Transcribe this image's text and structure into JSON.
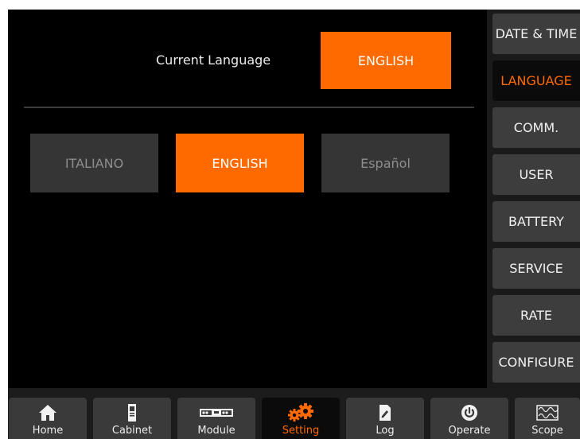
{
  "language_panel": {
    "current_label": "Current Language",
    "current_value": "ENGLISH",
    "options": [
      {
        "label": "ITALIANO",
        "selected": false
      },
      {
        "label": "ENGLISH",
        "selected": true
      },
      {
        "label": "Español",
        "selected": false
      }
    ]
  },
  "sidebar": {
    "items": [
      {
        "label": "DATE & TIME",
        "active": false
      },
      {
        "label": "LANGUAGE",
        "active": true
      },
      {
        "label": "COMM.",
        "active": false
      },
      {
        "label": "USER",
        "active": false
      },
      {
        "label": "BATTERY",
        "active": false
      },
      {
        "label": "SERVICE",
        "active": false
      },
      {
        "label": "RATE",
        "active": false
      },
      {
        "label": "CONFIGURE",
        "active": false
      }
    ]
  },
  "bottom_nav": {
    "items": [
      {
        "label": "Home",
        "icon": "home-icon",
        "active": false
      },
      {
        "label": "Cabinet",
        "icon": "cabinet-icon",
        "active": false
      },
      {
        "label": "Module",
        "icon": "module-icon",
        "active": false
      },
      {
        "label": "Setting",
        "icon": "gears-icon",
        "active": true
      },
      {
        "label": "Log",
        "icon": "log-icon",
        "active": false
      },
      {
        "label": "Operate",
        "icon": "power-icon",
        "active": false
      },
      {
        "label": "Scope",
        "icon": "scope-icon",
        "active": false
      }
    ]
  },
  "colors": {
    "accent": "#ff6a00",
    "background": "#000000",
    "button": "#353535"
  }
}
